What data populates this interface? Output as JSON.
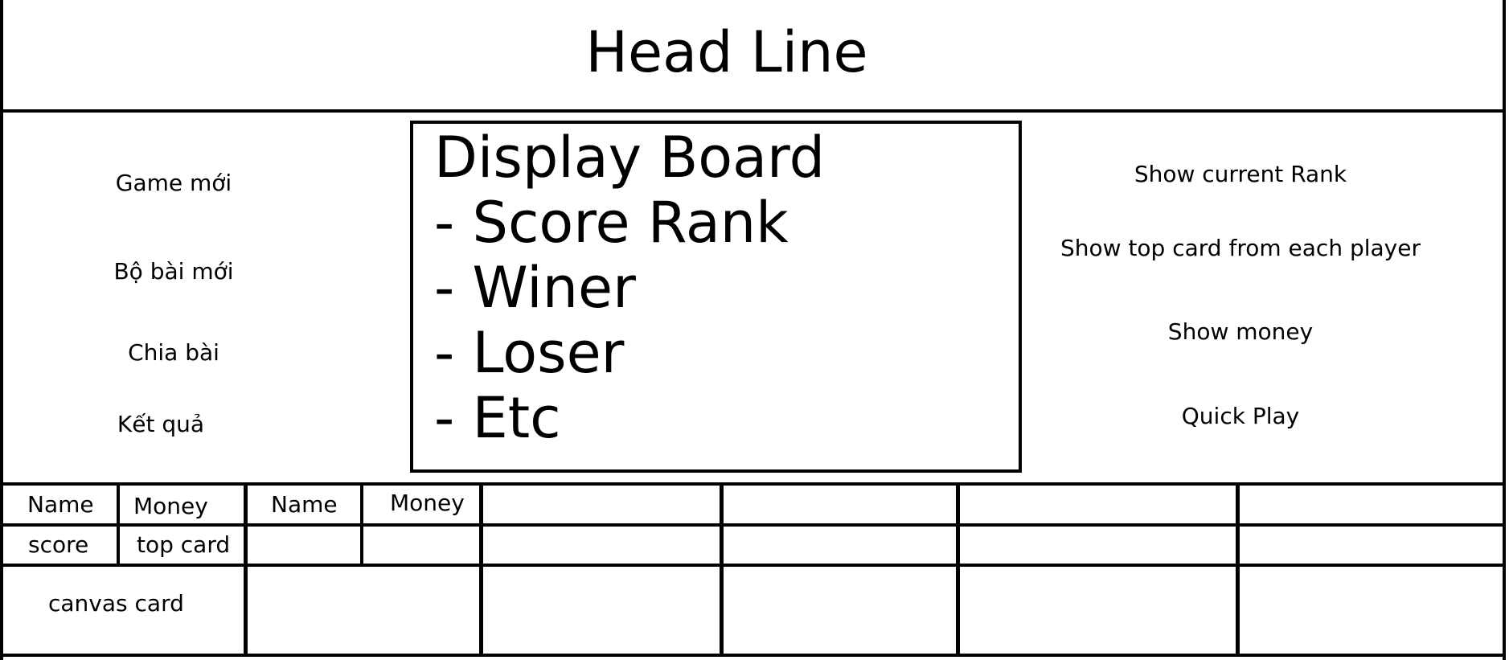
{
  "header": {
    "title": "Head Line"
  },
  "left_menu": {
    "items": [
      "Game mới",
      "Bộ bài mới",
      "Chia bài",
      "Kết quả"
    ]
  },
  "display_board": {
    "title": "Display Board",
    "items": [
      "- Score Rank",
      "- Winer",
      "- Loser",
      "- Etc"
    ]
  },
  "right_panel": {
    "items": [
      "Show current Rank",
      "Show top card from each player",
      "Show money",
      "Quick Play"
    ]
  },
  "player_grid": {
    "player1": {
      "name": "Name",
      "money": "Money",
      "score": "score",
      "top_card": "top card",
      "canvas": "canvas card"
    },
    "player2": {
      "name": "Name",
      "money": "Money"
    }
  }
}
